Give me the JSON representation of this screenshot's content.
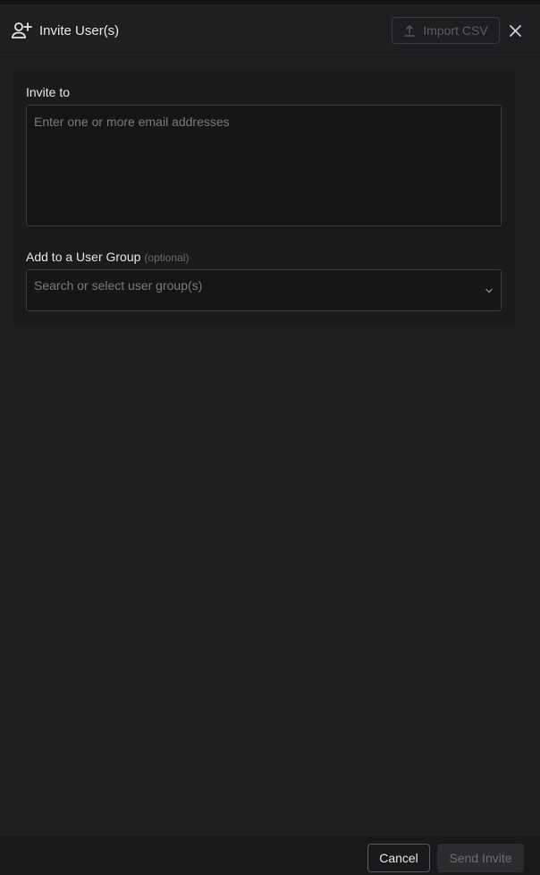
{
  "header": {
    "title": "Invite User(s)",
    "icon": "add-user-icon",
    "import_label": "Import CSV",
    "import_icon": "upload-icon",
    "close_icon": "close-icon"
  },
  "form": {
    "invite_label": "Invite to",
    "email_placeholder": "Enter one or more email addresses",
    "email_value": "",
    "group_label": "Add to a User Group",
    "group_optional": "(optional)",
    "group_placeholder": "Search or select user group(s)",
    "group_value": "",
    "group_chevron_icon": "chevron-down-icon"
  },
  "footer": {
    "cancel_label": "Cancel",
    "send_label": "Send Invite"
  },
  "colors": {
    "background": "#1e1e21",
    "field_background": "#161617",
    "field_border": "#3c3c40",
    "disabled_text": "#6e6e73"
  }
}
